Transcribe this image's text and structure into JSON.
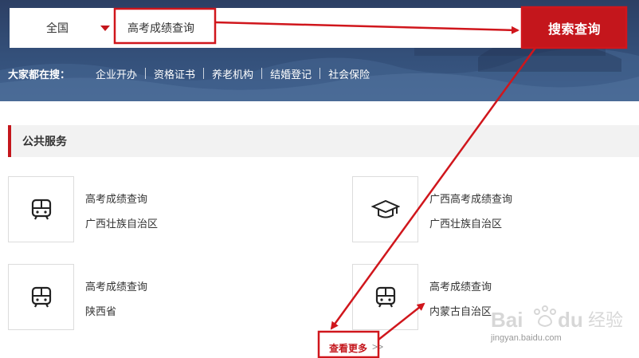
{
  "search": {
    "region": "全国",
    "query": "高考成绩查询",
    "button_label": "搜索查询"
  },
  "hot": {
    "label": "大家都在搜：",
    "items": [
      "企业开办",
      "资格证书",
      "养老机构",
      "结婚登记",
      "社会保险"
    ]
  },
  "section": {
    "title": "公共服务"
  },
  "services": [
    {
      "title": "高考成绩查询",
      "region": "广西壮族自治区",
      "icon": "bus-icon"
    },
    {
      "title": "广西高考成绩查询",
      "region": "广西壮族自治区",
      "icon": "graduation-cap-icon"
    },
    {
      "title": "高考成绩查询",
      "region": "陕西省",
      "icon": "bus-icon"
    },
    {
      "title": "高考成绩查询",
      "region": "内蒙古自治区",
      "icon": "bus-icon"
    }
  ],
  "more": {
    "label": "查看更多",
    "arrows": ">>"
  },
  "watermark": {
    "brand": "Baidu 经验",
    "url": "jingyan.baidu.com"
  },
  "colors": {
    "accent": "#c4161c",
    "banner": "#34507a"
  }
}
